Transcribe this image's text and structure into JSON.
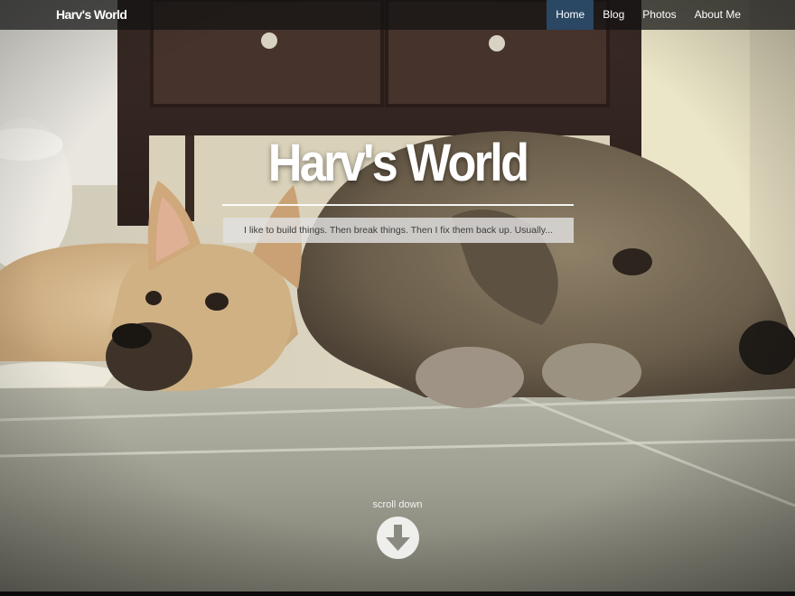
{
  "navbar": {
    "brand": "Harv's World",
    "items": [
      {
        "label": "Home",
        "active": true
      },
      {
        "label": "Blog",
        "active": false
      },
      {
        "label": "Photos",
        "active": false
      },
      {
        "label": "About Me",
        "active": false
      }
    ],
    "active_color": "#2a4763"
  },
  "hero": {
    "title": "Harv's World",
    "tagline": "I like to build things. Then break things. Then I fix them back up. Usually...",
    "background_image": "two dogs lying on a tiled bathroom floor",
    "scroll_label": "scroll down",
    "scroll_icon": "arrow-down-circle-icon"
  }
}
